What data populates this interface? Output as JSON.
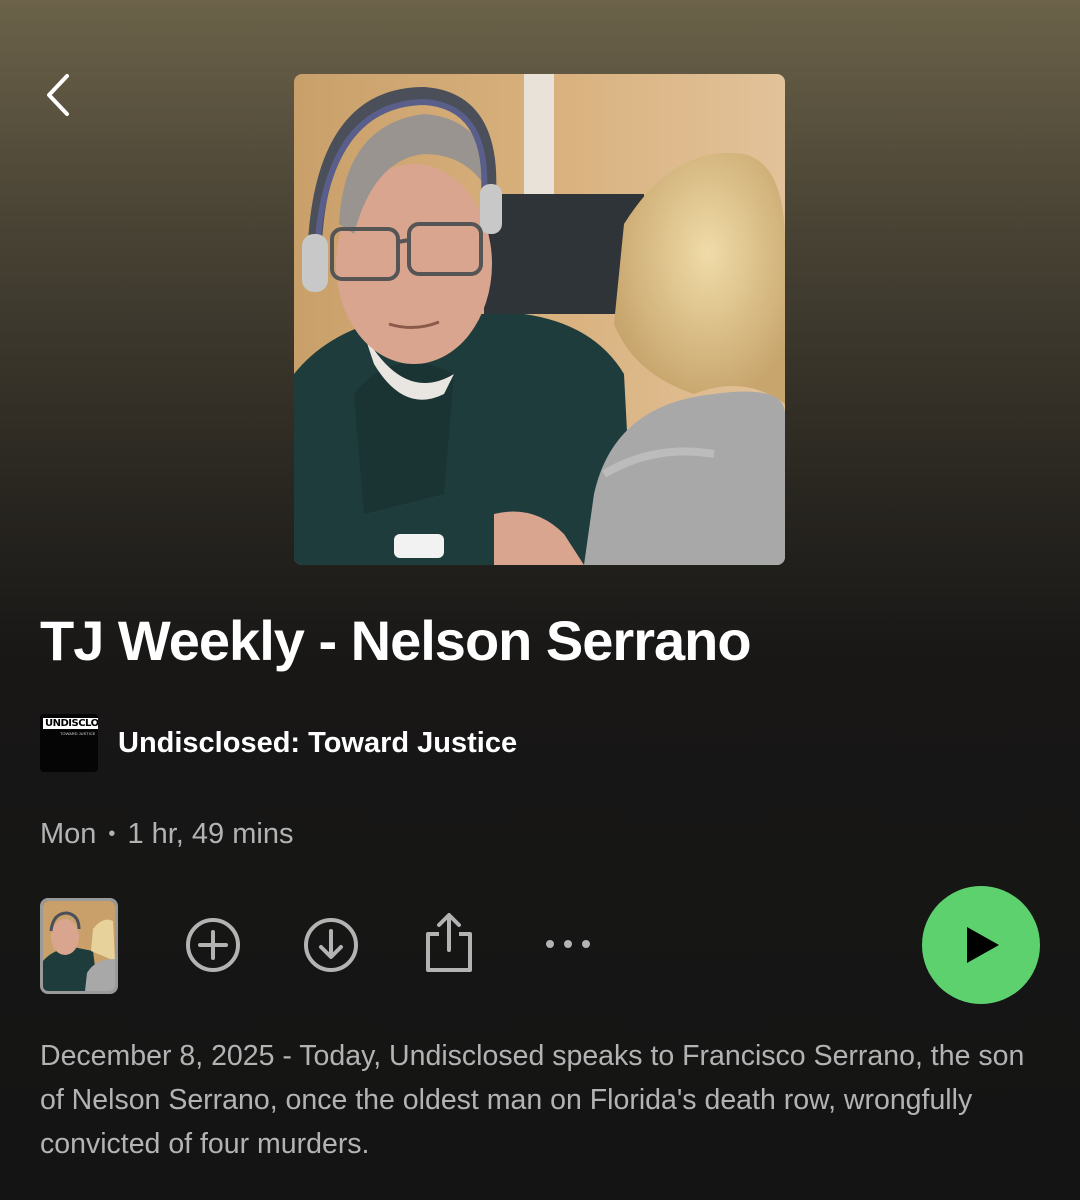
{
  "navigation": {
    "back_icon": "chevron-left-icon"
  },
  "episode": {
    "title": "TJ Weekly - Nelson Serrano",
    "show_name": "Undisclosed: Toward Justice",
    "show_logo_text": "UNDISCLOSED",
    "show_logo_subtext": "TOWARD JUSTICE",
    "day": "Mon",
    "separator": "•",
    "duration": "1 hr, 49 mins",
    "description": "December 8, 2025 - Today, Undisclosed speaks to Francisco Serrano, the son of Nelson Serrano, once the oldest man on Florida's death row, wrongfully convicted of four murders."
  },
  "actions": {
    "add_icon": "plus-circle-icon",
    "download_icon": "download-circle-icon",
    "share_icon": "share-icon",
    "more_icon": "more-horizontal-icon",
    "play_icon": "play-icon"
  },
  "colors": {
    "accent": "#5ed16f",
    "text_primary": "#ffffff",
    "text_secondary": "#b3b3b3",
    "background": "#141414"
  }
}
